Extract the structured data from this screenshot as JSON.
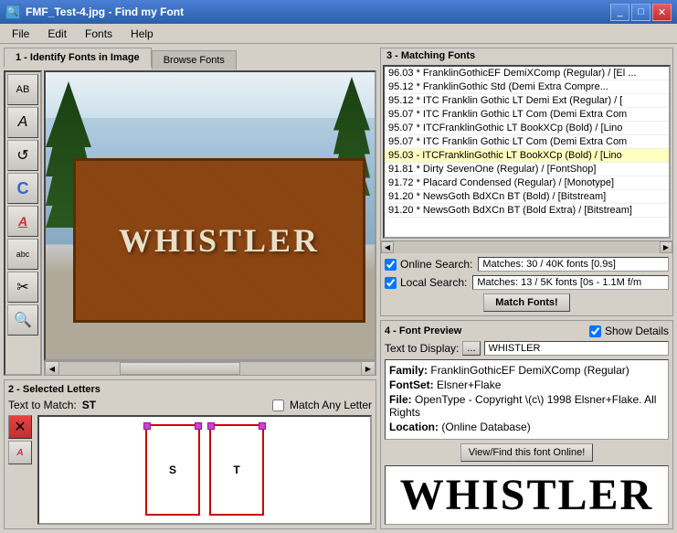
{
  "window": {
    "title": "FMF_Test-4.jpg - Find my Font",
    "icon": "🔍"
  },
  "menu": {
    "items": [
      "File",
      "Edit",
      "Fonts",
      "Help"
    ]
  },
  "tabs": {
    "tab1": "1 - Identify Fonts in Image",
    "tab2": "Browse Fonts"
  },
  "image_section": {
    "title": "1 - Identify Fonts in Image",
    "whistler_text": "WHISTLER"
  },
  "matching_fonts": {
    "title": "3 - Matching Fonts",
    "fonts": [
      "96.03 * FranklinGothicEF DemiXComp (Regular) / [El ...",
      "95.12 * FranklinGothic Std (Demi Extra Compre...",
      "95.12 * ITC Franklin Gothic LT Demi Ext (Regular) / [",
      "95.07 * ITC Franklin Gothic LT Com (Demi Extra Com",
      "95.07 * ITCFranklinGothic LT BookXCp (Bold) / [Lino",
      "95.07 * ITC Franklin Gothic LT Com (Demi Extra Com",
      "95.03 - ITCFranklinGothic LT BookXCp (Bold) / [Lino",
      "91.81 * Dirty SevenOne (Regular) / [FontShop]",
      "91.72 * Placard Condensed (Regular) / [Monotype]",
      "91.20 * NewsGoth BdXCn BT (Bold) / [Bitstream]",
      "91.20 * NewsGoth BdXCn BT (Bold Extra) / [Bitstream]"
    ],
    "selected_index": 6,
    "highlighted_index": 6
  },
  "search": {
    "online_label": "Online Search:",
    "online_result": "Matches: 30 / 40K fonts [0.9s]",
    "local_label": "Local Search:",
    "local_result": "Matches: 13 / 5K fonts [0s - 1.1M f/m",
    "match_button": "Match Fonts!"
  },
  "selected_letters": {
    "title": "2 - Selected Letters",
    "text_to_match_label": "Text to Match:",
    "text_to_match_value": "ST",
    "match_any_label": "Match Any Letter",
    "letters": [
      "S",
      "T"
    ]
  },
  "font_preview": {
    "title": "4 - Font Preview",
    "show_details_label": "Show Details",
    "text_to_display_label": "Text to Display:",
    "text_to_display_btn": "...",
    "text_to_display_value": "WHISTLER",
    "family_label": "Family:",
    "family_value": "FranklinGothicEF DemiXComp (Regular)",
    "fontset_label": "FontSet:",
    "fontset_value": "Elsner+Flake",
    "file_label": "File:",
    "file_value": "OpenType  - Copyright \\(c\\) 1998 Elsner+Flake. All Rights",
    "location_label": "Location:",
    "location_value": "(Online Database)",
    "view_button": "View/Find this font Online!",
    "preview_text": "WHISTLER"
  },
  "tools": {
    "items": [
      "AB",
      "A",
      "↺",
      "C",
      "A",
      "abc",
      "✂",
      "🔍"
    ]
  },
  "colors": {
    "accent": "#316ac5",
    "selected_font_bg": "#ffffc0",
    "title_bg": "#4a7fd4",
    "highlight_red": "#cc0000"
  }
}
